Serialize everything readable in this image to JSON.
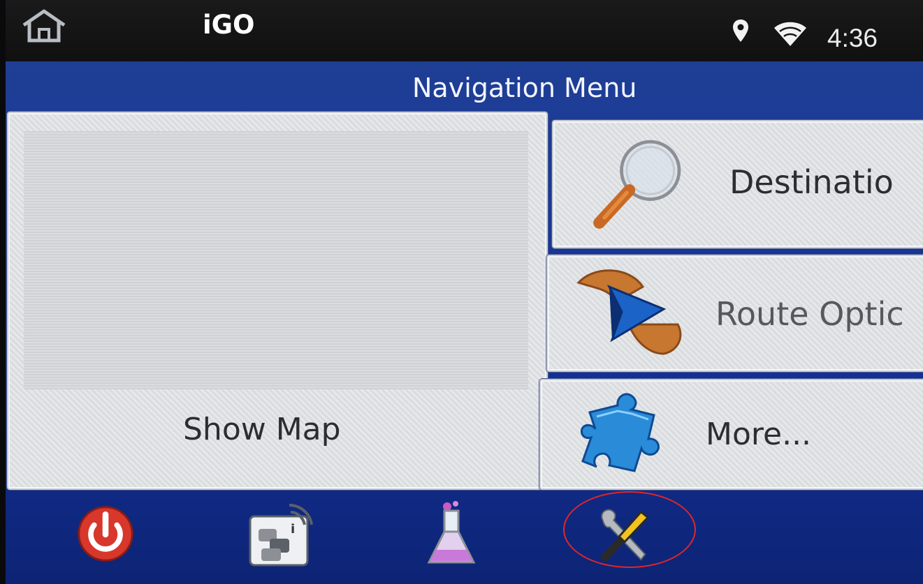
{
  "status_bar": {
    "app_title": "iGO",
    "clock": "4:36",
    "icons": [
      "home-icon",
      "location-pin-icon",
      "wifi-icon"
    ]
  },
  "panel": {
    "title": "Navigation Menu"
  },
  "tiles": {
    "show_map": "Show Map",
    "destination": "Destinatio",
    "route_options": "Route Optic",
    "more": "More..."
  },
  "bottom_bar": {
    "icons": [
      "power-icon",
      "traffic-info-icon",
      "flask-icon",
      "tools-icon"
    ]
  },
  "colors": {
    "panel_blue": "#14319a",
    "highlight": "#e0262a",
    "power_red": "#d8372b"
  }
}
